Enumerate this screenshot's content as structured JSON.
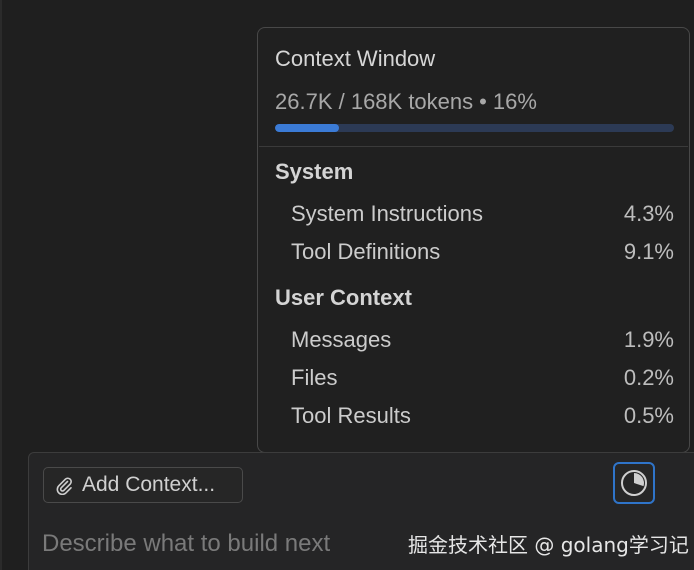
{
  "context_window": {
    "title": "Context Window",
    "usage_tokens": "26.7K / 168K tokens",
    "usage_separator": "•",
    "usage_percent": "16%",
    "progress_fraction": 0.16,
    "sections": [
      {
        "title": "System",
        "items": [
          {
            "label": "System Instructions",
            "percent": "4.3%"
          },
          {
            "label": "Tool Definitions",
            "percent": "9.1%"
          }
        ]
      },
      {
        "title": "User Context",
        "items": [
          {
            "label": "Messages",
            "percent": "1.9%"
          },
          {
            "label": "Files",
            "percent": "0.2%"
          },
          {
            "label": "Tool Results",
            "percent": "0.5%"
          }
        ]
      }
    ]
  },
  "composer": {
    "add_context_label": "Add Context...",
    "input_placeholder": "Describe what to build next",
    "add_context_icon": "paperclip-icon",
    "context_usage_icon": "pie-chart-icon"
  },
  "watermark": "掘金技术社区 @ golang学习记",
  "colors": {
    "background": "#1f1f1f",
    "popover_bg": "#202020",
    "accent_blue": "#3b7bd6",
    "focus_border": "#2f74c9"
  }
}
